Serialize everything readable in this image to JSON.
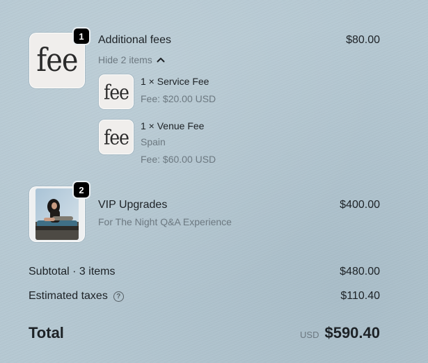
{
  "lines": [
    {
      "quantity_badge": "1",
      "thumb_text": "fee",
      "title": "Additional fees",
      "price": "$80.00",
      "toggle_label": "Hide 2 items",
      "components": [
        {
          "thumb_text": "fee",
          "title": "1 × Service Fee",
          "details": [
            "Fee: $20.00 USD"
          ]
        },
        {
          "thumb_text": "fee",
          "title": "1 × Venue Fee",
          "details": [
            "Spain",
            "Fee: $60.00 USD"
          ]
        }
      ]
    },
    {
      "quantity_badge": "2",
      "title": "VIP Upgrades",
      "subtitle": "For The Night Q&A Experience",
      "price": "$400.00"
    }
  ],
  "summary": {
    "subtotal_label": "Subtotal · 3 items",
    "subtotal_value": "$480.00",
    "taxes_label": "Estimated taxes",
    "taxes_help_icon": "?",
    "taxes_value": "$110.40",
    "total_label": "Total",
    "currency": "USD",
    "total_value": "$590.40"
  }
}
